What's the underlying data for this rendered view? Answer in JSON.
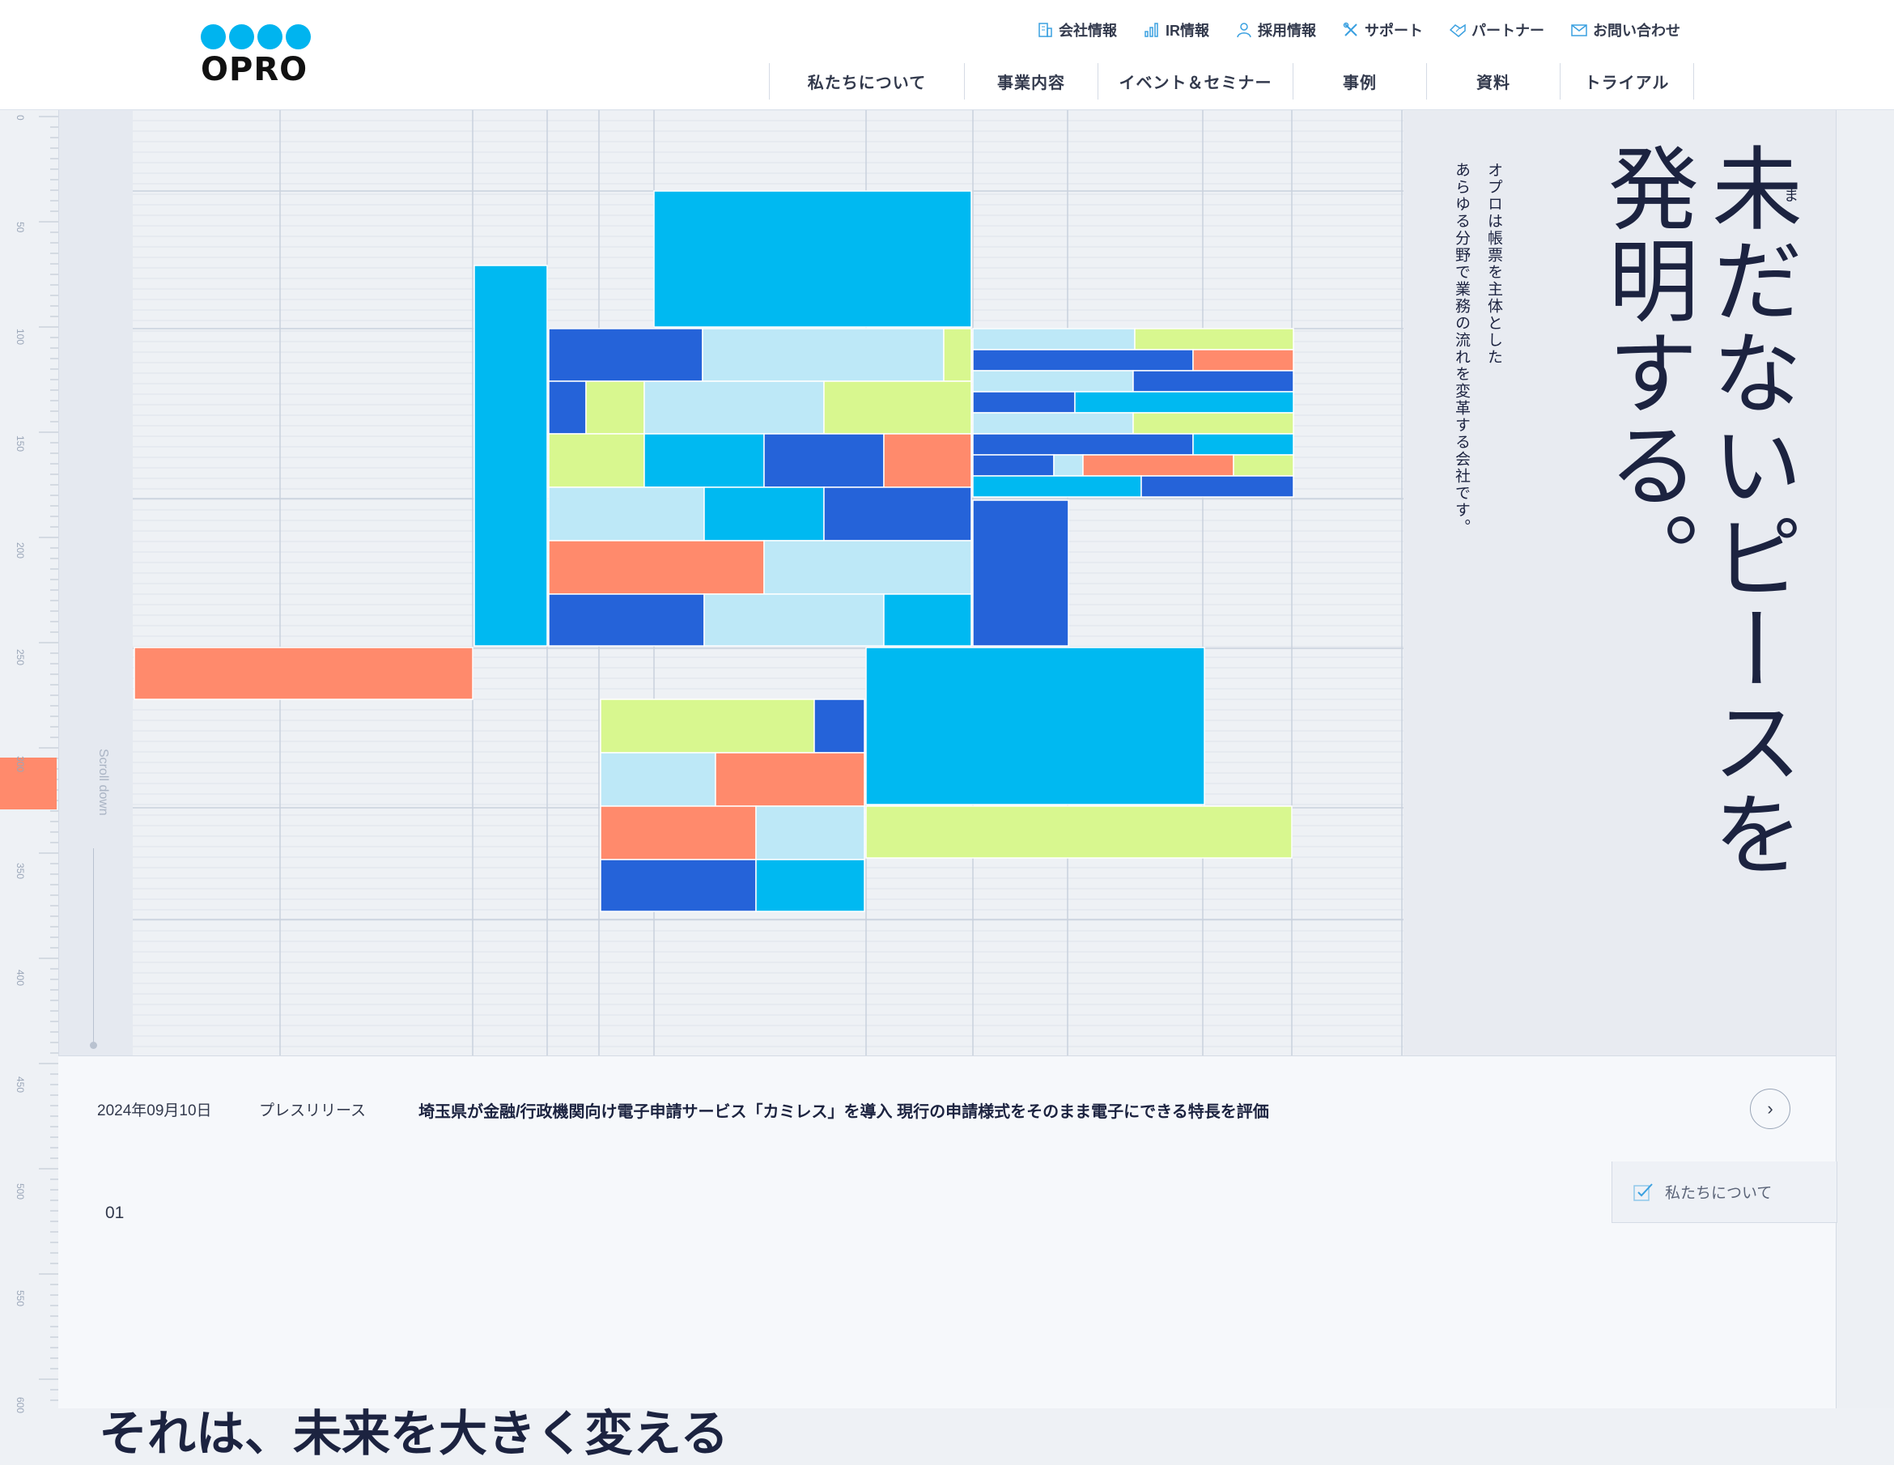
{
  "brand": {
    "logo_text": "OPRO",
    "accent": "#00b4ef"
  },
  "utility_nav": [
    {
      "label": "会社情報",
      "icon": "building-icon"
    },
    {
      "label": "IR情報",
      "icon": "bar-chart-icon"
    },
    {
      "label": "採用情報",
      "icon": "person-icon"
    },
    {
      "label": "サポート",
      "icon": "tools-icon"
    },
    {
      "label": "パートナー",
      "icon": "handshake-icon"
    },
    {
      "label": "お問い合わせ",
      "icon": "mail-icon"
    }
  ],
  "main_nav": [
    {
      "label": "私たちについて"
    },
    {
      "label": "事業内容"
    },
    {
      "label": "イベント＆セミナー"
    },
    {
      "label": "事例"
    },
    {
      "label": "資料"
    },
    {
      "label": "トライアル"
    }
  ],
  "ruler": {
    "ticks": [
      "0",
      "50",
      "100",
      "150",
      "200",
      "250",
      "300",
      "350",
      "400",
      "450",
      "500",
      "550",
      "600"
    ]
  },
  "scroll_hint": "Scroll down",
  "hero": {
    "headline_line1": "未だないピースを",
    "headline_line2": "発明する。",
    "ruby": "ま",
    "sub_line1": "オプロは帳票を主体とした",
    "sub_line2": "あらゆる分野で業務の流れを変革する会社です。"
  },
  "palette": {
    "cyan": "#00b9f1",
    "blue": "#2563d9",
    "light_blue": "#bde8f7",
    "lime": "#d8f78f",
    "coral": "#ff8a6c"
  },
  "news": {
    "date": "2024年09月10日",
    "category": "プレスリリース",
    "title": "埼玉県が金融/行政機関向け電子申請サービス「カミレス」を導入 現行の申請様式をそのまま電子にできる特長を評価"
  },
  "section": {
    "number": "01",
    "tab_label": "私たちについて",
    "heading": "それは、未来を大きく変える"
  }
}
